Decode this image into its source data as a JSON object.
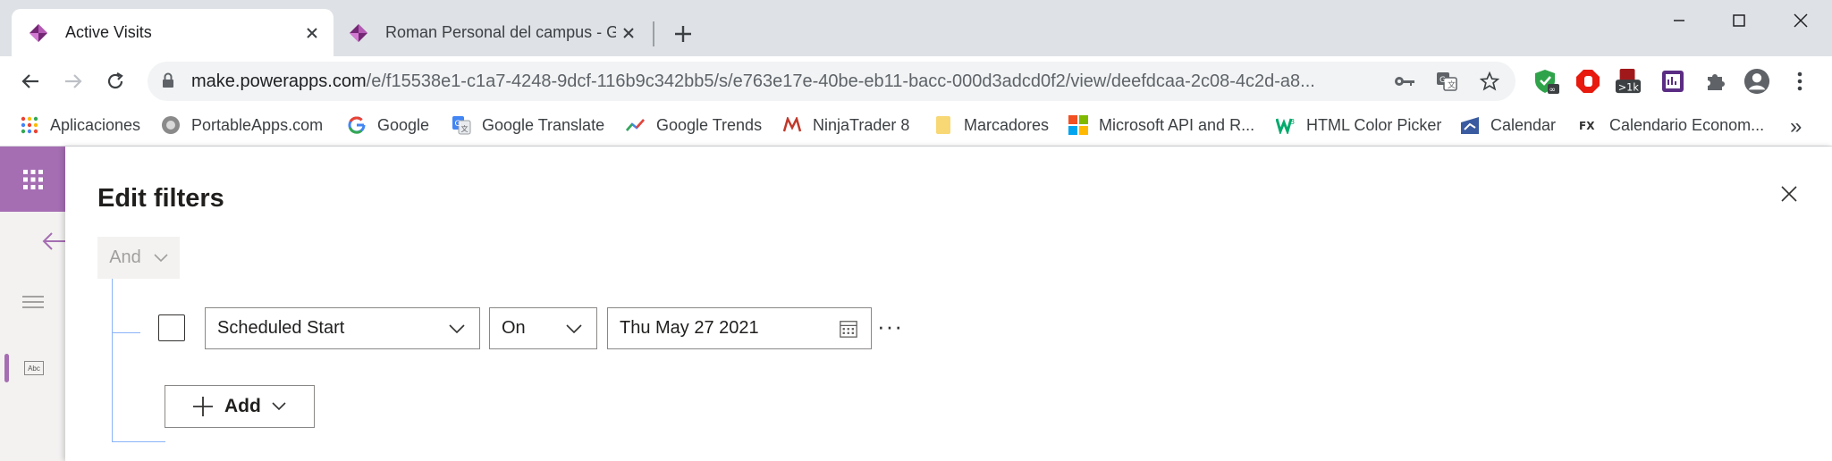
{
  "browser": {
    "tabs": [
      {
        "title": "Active Visits",
        "active": true
      },
      {
        "title": "Roman Personal del campus - Gu",
        "active": false
      }
    ],
    "url_host": "make.powerapps.com",
    "url_path": "/e/f15538e1-c1a7-4248-9dcf-116b9c342bb5/s/e763e17e-40be-eb11-bacc-000d3adcd0f2/view/deefdcaa-2c08-4c2d-a8...",
    "extension_badge": ">1k",
    "bookmarks": [
      {
        "label": "Aplicaciones",
        "icon": "apps-grid-icon"
      },
      {
        "label": "PortableApps.com",
        "icon": "portableapps-icon"
      },
      {
        "label": "Google",
        "icon": "google-icon"
      },
      {
        "label": "Google Translate",
        "icon": "google-translate-icon"
      },
      {
        "label": "Google Trends",
        "icon": "google-trends-icon"
      },
      {
        "label": "NinjaTrader 8",
        "icon": "ninjatrader-icon"
      },
      {
        "label": "Marcadores",
        "icon": "folder-icon"
      },
      {
        "label": "Microsoft API and R...",
        "icon": "microsoft-icon"
      },
      {
        "label": "HTML Color Picker",
        "icon": "w3schools-icon"
      },
      {
        "label": "Calendar",
        "icon": "calendar-bookmark-icon"
      },
      {
        "label": "Calendario Econom...",
        "icon": "fxstreet-icon"
      }
    ],
    "bookmarks_more": "»"
  },
  "app": {
    "rail_abc": "Abc"
  },
  "panel": {
    "title": "Edit filters",
    "group_operator": "And",
    "filter_row": {
      "field": "Scheduled Start",
      "operator": "On",
      "value": "Thu May 27 2021",
      "more": "···"
    },
    "add_label": "Add"
  },
  "colors": {
    "powerapps_purple": "#a56eb3",
    "tree_line": "#8ab4f8"
  }
}
